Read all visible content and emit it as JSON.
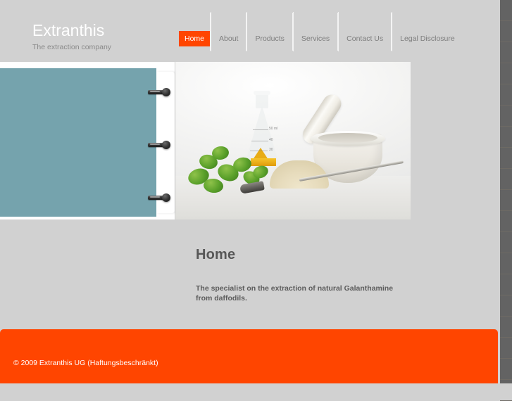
{
  "brand": {
    "title": "Extranthis",
    "tagline": "The extraction company"
  },
  "nav": {
    "items": [
      {
        "label": "Home",
        "active": true
      },
      {
        "label": "About",
        "active": false
      },
      {
        "label": "Products",
        "active": false
      },
      {
        "label": "Services",
        "active": false
      },
      {
        "label": "Contact Us",
        "active": false
      },
      {
        "label": "Legal Disclosure",
        "active": false
      }
    ]
  },
  "hero": {
    "notepad_alt": "teal notepad panel with three binder rings",
    "photo_alt": "laboratory still life: erlenmeyer flask with yellow liquid, mortar and pestle, green herb leaves, pale powder and a metal spatula"
  },
  "main": {
    "title": "Home",
    "intro": "The specialist on the extraction of natural Galanthamine from daffodils."
  },
  "footer": {
    "copyright": "© 2009 Extranthis UG (Haftungsbeschränkt)"
  },
  "flask_markings": {
    "m1": "50 ml",
    "m2": "40",
    "m3": "30"
  },
  "colors": {
    "background": "#d1d1d1",
    "accent": "#ff4500",
    "teal": "#75a3ad",
    "rail": "#636363",
    "nav_text": "#7d7d7d",
    "heading": "#575757"
  }
}
